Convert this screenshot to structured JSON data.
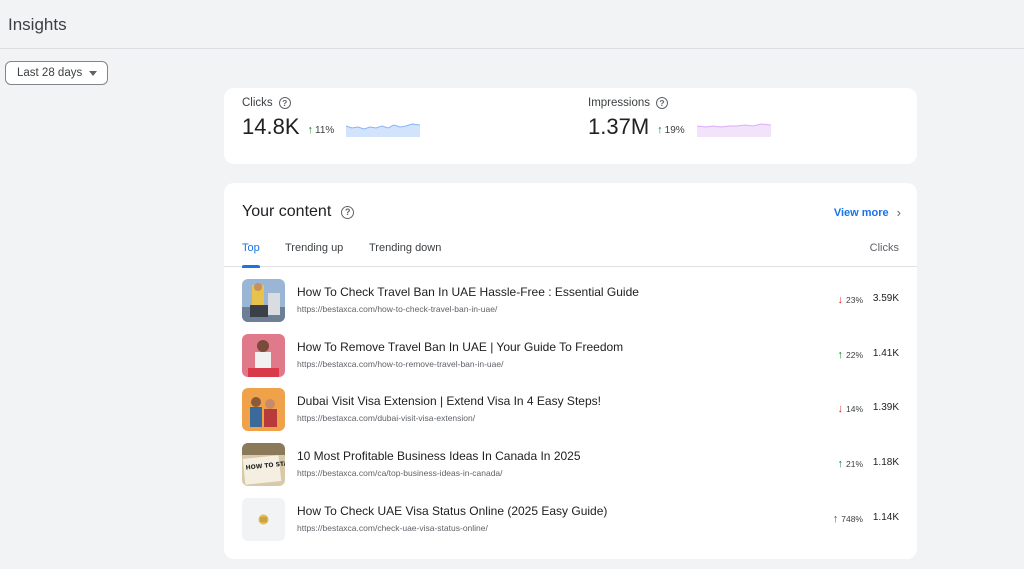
{
  "header": {
    "title": "Insights"
  },
  "filter": {
    "date_range": "Last 28 days"
  },
  "metrics": {
    "clicks": {
      "label": "Clicks",
      "value": "14.8K",
      "delta": "11%",
      "trend": "up"
    },
    "impressions": {
      "label": "Impressions",
      "value": "1.37M",
      "delta": "19%",
      "trend": "up"
    }
  },
  "colors": {
    "clicks_spark": "#aecbfa",
    "impressions_spark": "#e8c7f5",
    "accent": "#1a73e8",
    "up": "#188038",
    "down": "#d93025"
  },
  "content": {
    "title": "Your content",
    "view_more": "View more",
    "tabs": [
      {
        "label": "Top",
        "active": true
      },
      {
        "label": "Trending up",
        "active": false
      },
      {
        "label": "Trending down",
        "active": false
      }
    ],
    "column_header": "Clicks",
    "items": [
      {
        "title": "How To Check Travel Ban In UAE Hassle-Free : Essential Guide",
        "url": "https://bestaxca.com/how-to-check-travel-ban-in-uae/",
        "change": "23%",
        "trend": "down",
        "clicks": "3.59K"
      },
      {
        "title": "How To Remove Travel Ban In UAE | Your Guide To Freedom",
        "url": "https://bestaxca.com/how-to-remove-travel-ban-in-uae/",
        "change": "22%",
        "trend": "up",
        "clicks": "1.41K"
      },
      {
        "title": "Dubai Visit Visa Extension | Extend Visa In 4 Easy Steps!",
        "url": "https://bestaxca.com/dubai-visit-visa-extension/",
        "change": "14%",
        "trend": "down",
        "clicks": "1.39K"
      },
      {
        "title": "10 Most Profitable Business Ideas In Canada In 2025",
        "url": "https://bestaxca.com/ca/top-business-ideas-in-canada/",
        "change": "21%",
        "trend": "up",
        "clicks": "1.18K"
      },
      {
        "title": "How To Check UAE Visa Status Online (2025 Easy Guide)",
        "url": "https://bestaxca.com/check-uae-visa-status-online/",
        "change": "748%",
        "trend": "up",
        "clicks": "1.14K"
      }
    ]
  },
  "thumb_text": {
    "business": "HOW TO START BUSINESS ONLINE"
  }
}
